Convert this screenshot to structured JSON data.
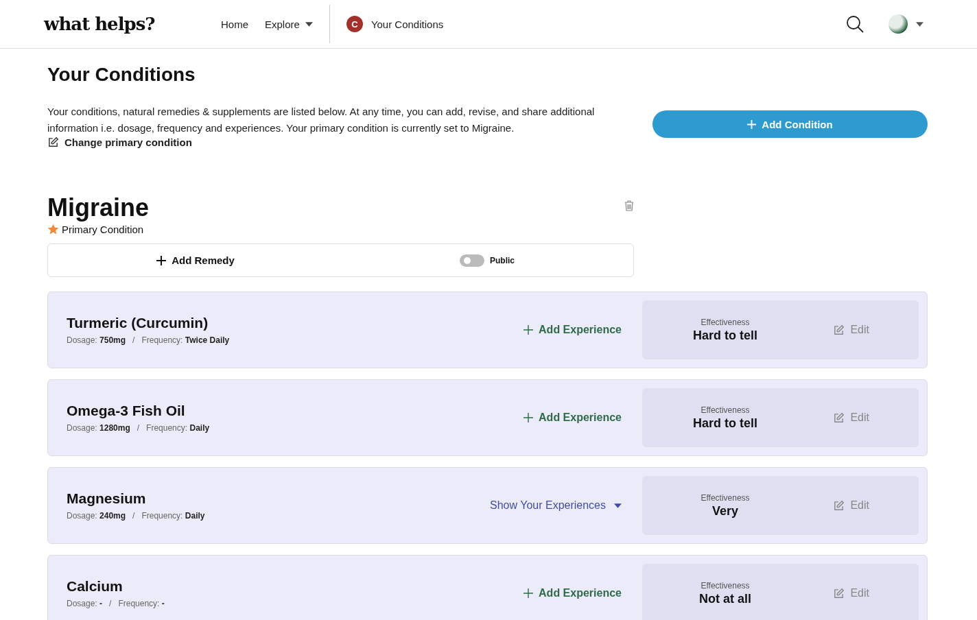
{
  "header": {
    "logo": "what helps?",
    "nav": [
      {
        "label": "Home",
        "dropdown": false
      },
      {
        "label": "Explore",
        "dropdown": true
      }
    ],
    "conditions_link": {
      "badge": "C",
      "label": "Your Conditions"
    }
  },
  "page": {
    "title": "Your Conditions",
    "description": "Your conditions, natural remedies & supplements are listed below. At any time, you can add, revise, and share additional information i.e. dosage, frequency and experiences. Your primary condition is currently set to Migraine.",
    "change_link": "Change primary condition",
    "add_button": "Add Condition"
  },
  "condition": {
    "name": "Migraine",
    "primary": true,
    "primary_label": "Primary Condition",
    "add_remedy": "Add Remedy",
    "public": {
      "label": "Public",
      "on": false
    }
  },
  "separator": "/",
  "remedies": [
    {
      "name": "Turmeric (Curcumin)",
      "dosage_label": "Dosage:",
      "dosage": "750mg",
      "frequency_label": "Frequency:",
      "frequency": "Twice Daily",
      "action": {
        "kind": "add",
        "label": "Add Experience"
      },
      "effectiveness_label": "Effectiveness",
      "effectiveness": "Hard to tell",
      "edit": "Edit"
    },
    {
      "name": "Omega-3 Fish Oil",
      "dosage_label": "Dosage:",
      "dosage": "1280mg",
      "frequency_label": "Frequency:",
      "frequency": "Daily",
      "action": {
        "kind": "add",
        "label": "Add Experience"
      },
      "effectiveness_label": "Effectiveness",
      "effectiveness": "Hard to tell",
      "edit": "Edit"
    },
    {
      "name": "Magnesium",
      "dosage_label": "Dosage:",
      "dosage": "240mg",
      "frequency_label": "Frequency:",
      "frequency": "Daily",
      "action": {
        "kind": "show",
        "label": "Show Your Experiences"
      },
      "effectiveness_label": "Effectiveness",
      "effectiveness": "Very",
      "edit": "Edit"
    },
    {
      "name": "Calcium",
      "dosage_label": "Dosage:",
      "dosage": "-",
      "frequency_label": "Frequency:",
      "frequency": "-",
      "action": {
        "kind": "add",
        "label": "Add Experience"
      },
      "effectiveness_label": "Effectiveness",
      "effectiveness": "Not at all",
      "edit": "Edit"
    }
  ]
}
